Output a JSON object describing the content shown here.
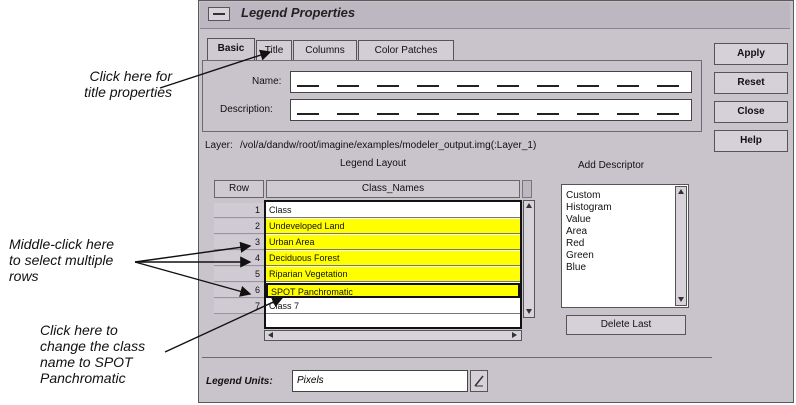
{
  "window": {
    "title": "Legend Properties"
  },
  "tabs": [
    "Basic",
    "Title",
    "Columns",
    "Color Patches"
  ],
  "form": {
    "name_label": "Name:",
    "description_label": "Description:",
    "layer_label": "Layer:",
    "layer_value": "/vol/a/dandw/root/imagine/examples/modeler_output.img(:Layer_1)"
  },
  "side_buttons": [
    "Apply",
    "Reset",
    "Close",
    "Help"
  ],
  "legend_layout": {
    "heading": "Legend Layout",
    "row_header": "Row",
    "col_header": "Class_Names",
    "rows": [
      {
        "num": "1",
        "name": "Class",
        "selected": false
      },
      {
        "num": "2",
        "name": "Undeveloped Land",
        "selected": true
      },
      {
        "num": "3",
        "name": "Urban Area",
        "selected": true
      },
      {
        "num": "4",
        "name": "Deciduous Forest",
        "selected": true
      },
      {
        "num": "5",
        "name": "Riparian Vegetation",
        "selected": true
      },
      {
        "num": "6",
        "name": "SPOT Panchromatic",
        "selected": true
      },
      {
        "num": "7",
        "name": "Class 7",
        "selected": false
      }
    ]
  },
  "add_descriptor": {
    "heading": "Add Descriptor",
    "items": [
      "Custom",
      "Histogram",
      "Value",
      "Area",
      "Red",
      "Green",
      "Blue"
    ],
    "delete_button": "Delete Last"
  },
  "legend_units": {
    "label": "Legend Units:",
    "value": "Pixels"
  },
  "annotations": {
    "title": [
      "Click here for",
      "title properties"
    ],
    "multi": [
      "Middle-click here",
      "to select multiple",
      "rows"
    ],
    "change": [
      "Click here to",
      "change the class",
      "name to SPOT",
      "Panchromatic"
    ]
  },
  "colors": {
    "selected_row": "#ffff00",
    "window_bg": "#c9c3cc"
  }
}
